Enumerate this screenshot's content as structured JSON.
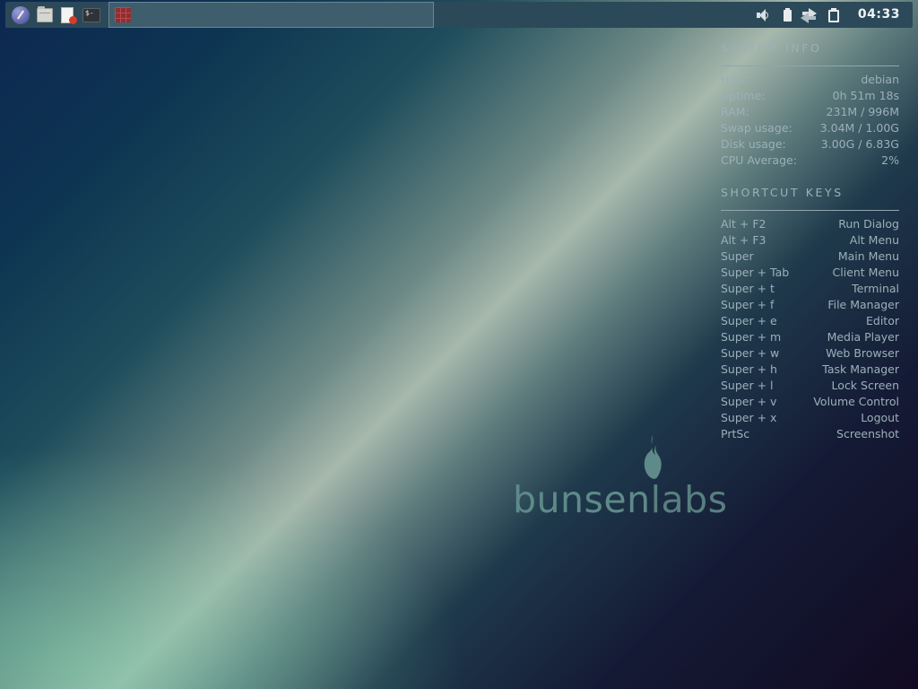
{
  "taskbar": {
    "launchers": [
      {
        "name": "menu",
        "icon": "bunsen-menu-icon"
      },
      {
        "name": "file-manager",
        "icon": "folder-icon"
      },
      {
        "name": "text-editor",
        "icon": "text-editor-icon"
      },
      {
        "name": "terminal",
        "icon": "terminal-icon",
        "glyph": "$-"
      }
    ],
    "active_window_icon": "app-window-icon",
    "tray": [
      "volume-icon",
      "battery-icon",
      "network-icon",
      "clipboard-icon"
    ],
    "clock": "04:33"
  },
  "system_info": {
    "heading": "SYSTEM INFO",
    "rows": [
      {
        "key": "Host:",
        "value": "debian"
      },
      {
        "key": "Uptime:",
        "value": "0h 51m 18s"
      },
      {
        "key": "RAM:",
        "value": "231M / 996M"
      },
      {
        "key": "Swap usage:",
        "value": "3.04M / 1.00G"
      },
      {
        "key": "Disk usage:",
        "value": "3.00G / 6.83G"
      },
      {
        "key": "CPU Average:",
        "value": "2%"
      }
    ]
  },
  "shortcut_keys": {
    "heading": "SHORTCUT KEYS",
    "rows": [
      {
        "key": "Alt + F2",
        "value": "Run Dialog"
      },
      {
        "key": "Alt + F3",
        "value": "Alt Menu"
      },
      {
        "key": "Super",
        "value": "Main Menu"
      },
      {
        "key": "Super + Tab",
        "value": "Client Menu"
      },
      {
        "key": "Super + t",
        "value": "Terminal"
      },
      {
        "key": "Super + f",
        "value": "File Manager"
      },
      {
        "key": "Super + e",
        "value": "Editor"
      },
      {
        "key": "Super + m",
        "value": "Media Player"
      },
      {
        "key": "Super + w",
        "value": "Web Browser"
      },
      {
        "key": "Super + h",
        "value": "Task Manager"
      },
      {
        "key": "Super + l",
        "value": "Lock Screen"
      },
      {
        "key": "Super + v",
        "value": "Volume Control"
      },
      {
        "key": "Super + x",
        "value": "Logout"
      },
      {
        "key": "PrtSc",
        "value": "Screenshot"
      }
    ]
  },
  "logo": {
    "text_bold": "bunsen",
    "text_light": "labs",
    "icon": "flame-icon"
  },
  "colors": {
    "panel": "#2c4959",
    "conky_text": "#9cb0b9",
    "logo": "#5e8a89"
  }
}
